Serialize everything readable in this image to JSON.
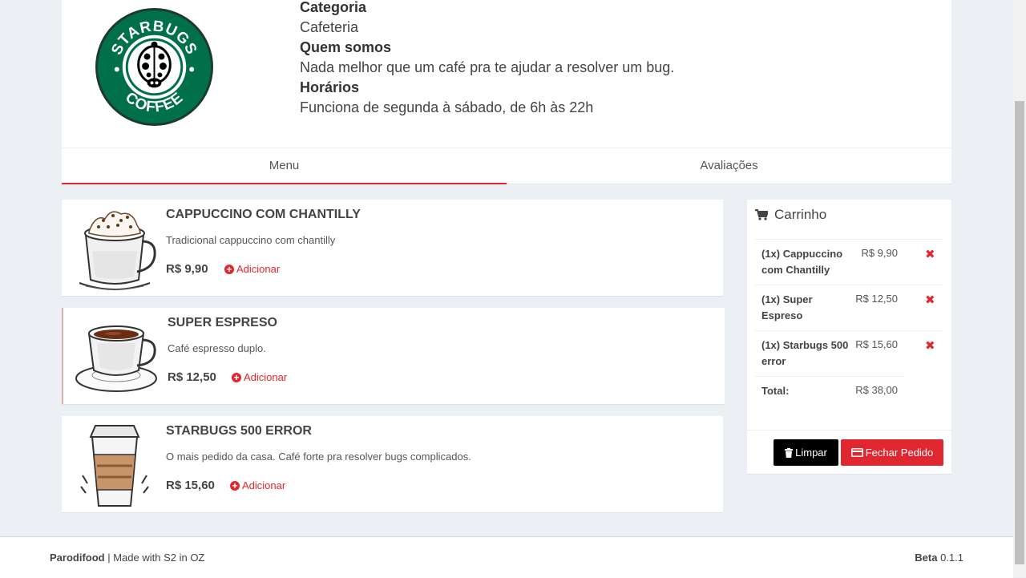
{
  "store": {
    "logo_text_top": "STARBUGS",
    "logo_text_bottom": "COFFEE",
    "category_label": "Categoria",
    "category_value": "Cafeteria",
    "about_label": "Quem somos",
    "about_value": "Nada melhor que um café pra te ajudar a resolver um bug.",
    "hours_label": "Horários",
    "hours_value": "Funciona de segunda à sábado, de 6h às 22h"
  },
  "tabs": [
    {
      "label": "Menu",
      "active": true
    },
    {
      "label": "Avaliações",
      "active": false
    }
  ],
  "menu_items": [
    {
      "name": "CAPPUCCINO COM CHANTILLY",
      "description": "Tradicional cappuccino com chantilly",
      "price": "R$ 9,90",
      "add_label": "Adicionar",
      "icon": "cappuccino-image"
    },
    {
      "name": "SUPER ESPRESO",
      "description": "Café espresso duplo.",
      "price": "R$ 12,50",
      "add_label": "Adicionar",
      "icon": "espresso-image"
    },
    {
      "name": "STARBUGS 500 ERROR",
      "description": "O mais pedido da casa. Café forte pra resolver bugs complicados.",
      "price": "R$ 15,60",
      "add_label": "Adicionar",
      "icon": "to-go-cup-image"
    }
  ],
  "cart": {
    "title": "Carrinho",
    "items": [
      {
        "name": "(1x) Cappuccino com Chantilly",
        "price": "R$ 9,90"
      },
      {
        "name": "(1x) Super Espreso",
        "price": "R$ 12,50"
      },
      {
        "name": "(1x) Starbugs 500 error",
        "price": "R$ 15,60"
      }
    ],
    "total_label": "Total:",
    "total_value": "R$ 38,00",
    "clear_label": "Limpar",
    "checkout_label": "Fechar Pedido"
  },
  "footer": {
    "brand": "Parodifood",
    "tagline": " | Made with S2 in OZ",
    "version_label": "Beta",
    "version_value": " 0.1.1"
  },
  "colors": {
    "accent": "#e02730",
    "background": "#ecf0f5",
    "logo_green": "#00704a"
  }
}
